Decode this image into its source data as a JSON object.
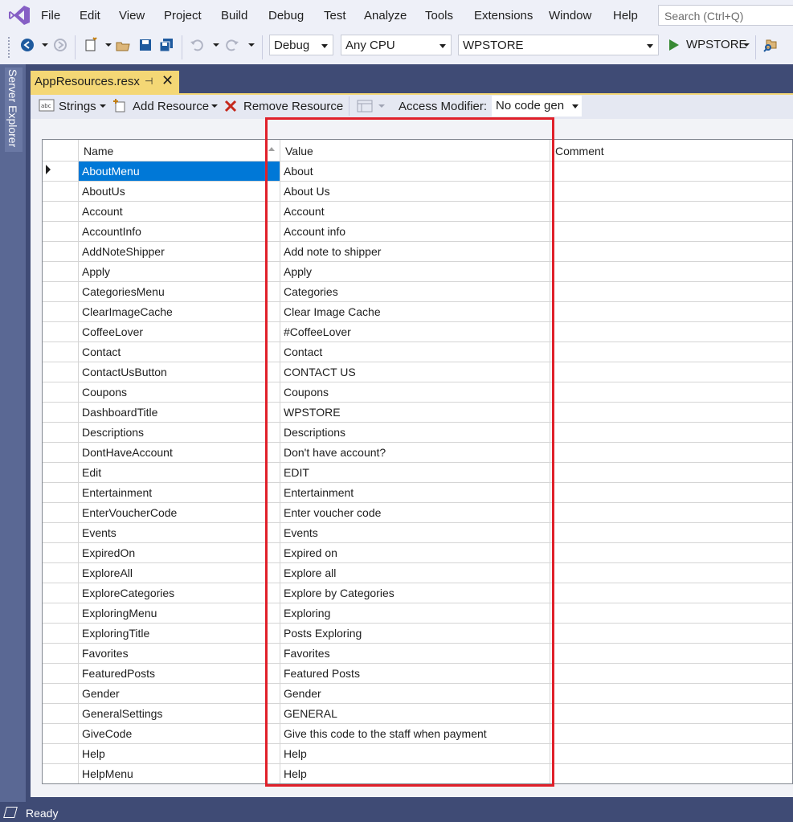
{
  "menu": [
    "File",
    "Edit",
    "View",
    "Project",
    "Build",
    "Debug",
    "Test",
    "Analyze",
    "Tools",
    "Extensions",
    "Window",
    "Help"
  ],
  "search": {
    "placeholder": "Search (Ctrl+Q)"
  },
  "toolbar": {
    "configuration": "Debug",
    "platform": "Any CPU",
    "startup_project": "WPSTORE",
    "run_label": "WPSTORE"
  },
  "side_panel": {
    "label": "Server Explorer"
  },
  "document_tab": {
    "title": "AppResources.resx"
  },
  "resource_toolbar": {
    "strings_label": "Strings",
    "add_label": "Add Resource",
    "remove_label": "Remove Resource",
    "access_modifier_label": "Access Modifier:",
    "access_modifier_value": "No code gen"
  },
  "grid": {
    "columns": [
      "Name",
      "Value",
      "Comment"
    ],
    "selected_row": 0,
    "rows": [
      {
        "name": "AboutMenu",
        "value": "About"
      },
      {
        "name": "AboutUs",
        "value": "About Us"
      },
      {
        "name": "Account",
        "value": "Account"
      },
      {
        "name": "AccountInfo",
        "value": "Account info"
      },
      {
        "name": "AddNoteShipper",
        "value": "Add note to shipper"
      },
      {
        "name": "Apply",
        "value": "Apply"
      },
      {
        "name": "CategoriesMenu",
        "value": "Categories"
      },
      {
        "name": "ClearImageCache",
        "value": "Clear Image Cache"
      },
      {
        "name": "CoffeeLover",
        "value": "#CoffeeLover"
      },
      {
        "name": "Contact",
        "value": "Contact"
      },
      {
        "name": "ContactUsButton",
        "value": "CONTACT US"
      },
      {
        "name": "Coupons",
        "value": "Coupons"
      },
      {
        "name": "DashboardTitle",
        "value": "WPSTORE"
      },
      {
        "name": "Descriptions",
        "value": "Descriptions"
      },
      {
        "name": "DontHaveAccount",
        "value": "Don't have account?"
      },
      {
        "name": "Edit",
        "value": "EDIT"
      },
      {
        "name": "Entertainment",
        "value": "Entertainment"
      },
      {
        "name": "EnterVoucherCode",
        "value": "Enter voucher code"
      },
      {
        "name": "Events",
        "value": "Events"
      },
      {
        "name": "ExpiredOn",
        "value": "Expired on"
      },
      {
        "name": "ExploreAll",
        "value": "Explore all"
      },
      {
        "name": "ExploreCategories",
        "value": "Explore by Categories"
      },
      {
        "name": "ExploringMenu",
        "value": "Exploring"
      },
      {
        "name": "ExploringTitle",
        "value": "Posts Exploring"
      },
      {
        "name": "Favorites",
        "value": "Favorites"
      },
      {
        "name": "FeaturedPosts",
        "value": "Featured Posts"
      },
      {
        "name": "Gender",
        "value": "Gender"
      },
      {
        "name": "GeneralSettings",
        "value": "GENERAL"
      },
      {
        "name": "GiveCode",
        "value": "Give this code to the staff when payment"
      },
      {
        "name": "Help",
        "value": "Help"
      },
      {
        "name": "HelpMenu",
        "value": "Help"
      }
    ]
  },
  "status": {
    "text": "Ready"
  },
  "colors": {
    "accent": "#0078d7",
    "highlight_box": "#e0202a",
    "tab_active": "#f4d775",
    "chrome": "#3f4b75"
  }
}
